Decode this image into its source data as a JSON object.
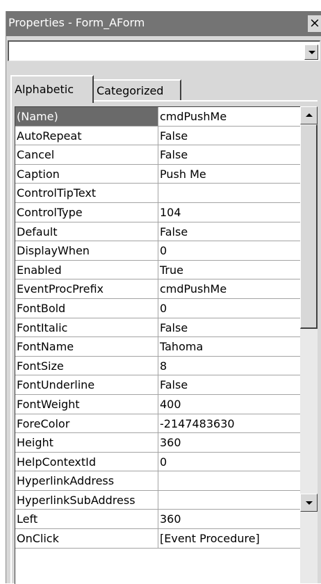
{
  "window": {
    "title": "Properties - Form_AForm",
    "close_glyph": "×"
  },
  "object_selector": {
    "value": ""
  },
  "tabs": [
    {
      "label": "Alphabetic",
      "active": true
    },
    {
      "label": "Categorized",
      "active": false
    }
  ],
  "properties": [
    {
      "name": "(Name)",
      "value": "cmdPushMe",
      "selected": true
    },
    {
      "name": "AutoRepeat",
      "value": "False"
    },
    {
      "name": "Cancel",
      "value": "False"
    },
    {
      "name": "Caption",
      "value": "Push Me"
    },
    {
      "name": "ControlTipText",
      "value": ""
    },
    {
      "name": "ControlType",
      "value": "104"
    },
    {
      "name": "Default",
      "value": "False"
    },
    {
      "name": "DisplayWhen",
      "value": "0"
    },
    {
      "name": "Enabled",
      "value": "True"
    },
    {
      "name": "EventProcPrefix",
      "value": "cmdPushMe"
    },
    {
      "name": "FontBold",
      "value": "0"
    },
    {
      "name": "FontItalic",
      "value": "False"
    },
    {
      "name": "FontName",
      "value": "Tahoma"
    },
    {
      "name": "FontSize",
      "value": "8"
    },
    {
      "name": "FontUnderline",
      "value": "False"
    },
    {
      "name": "FontWeight",
      "value": "400"
    },
    {
      "name": "ForeColor",
      "value": "-2147483630"
    },
    {
      "name": "Height",
      "value": "360"
    },
    {
      "name": "HelpContextId",
      "value": "0"
    },
    {
      "name": "HyperlinkAddress",
      "value": ""
    },
    {
      "name": "HyperlinkSubAddress",
      "value": ""
    },
    {
      "name": "Left",
      "value": "360"
    },
    {
      "name": "OnClick",
      "value": "[Event Procedure]"
    }
  ],
  "colors": {
    "titlebar": "#747474",
    "selected_row": "#6a6a6a",
    "panel": "#d8d8d8",
    "gridline": "#a3a3a3"
  },
  "icons": {
    "dropdown": "chevron-down-icon",
    "scroll_up": "arrow-up-icon",
    "scroll_down": "arrow-down-icon",
    "close": "close-icon"
  }
}
